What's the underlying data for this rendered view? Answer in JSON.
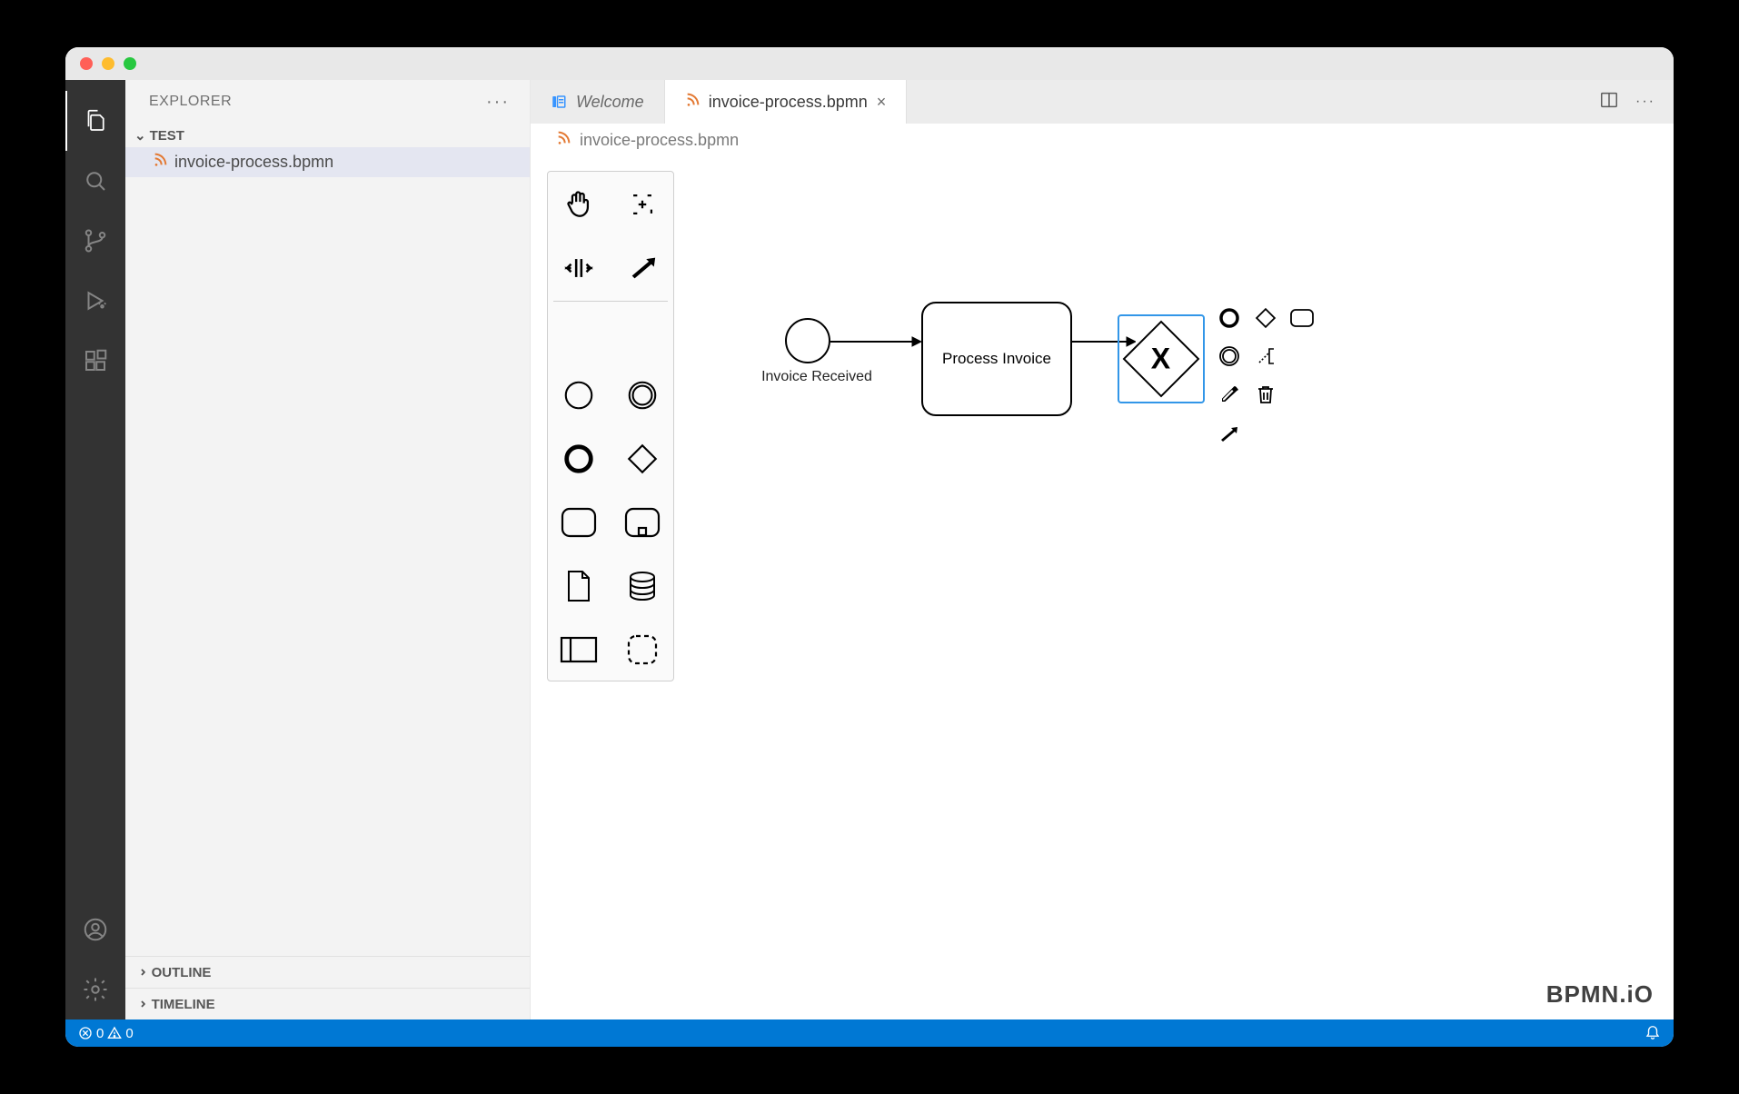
{
  "sidebar": {
    "title": "EXPLORER",
    "folder": "TEST",
    "file": "invoice-process.bpmn",
    "outline": "OUTLINE",
    "timeline": "TIMELINE"
  },
  "tabs": {
    "welcome": "Welcome",
    "file": "invoice-process.bpmn"
  },
  "breadcrumb": "invoice-process.bpmn",
  "diagram": {
    "start_label": "Invoice Received",
    "task_label": "Process Invoice",
    "gateway_marker": "X"
  },
  "statusbar": {
    "errors": "0",
    "warnings": "0"
  },
  "watermark": "BPMN.iO"
}
